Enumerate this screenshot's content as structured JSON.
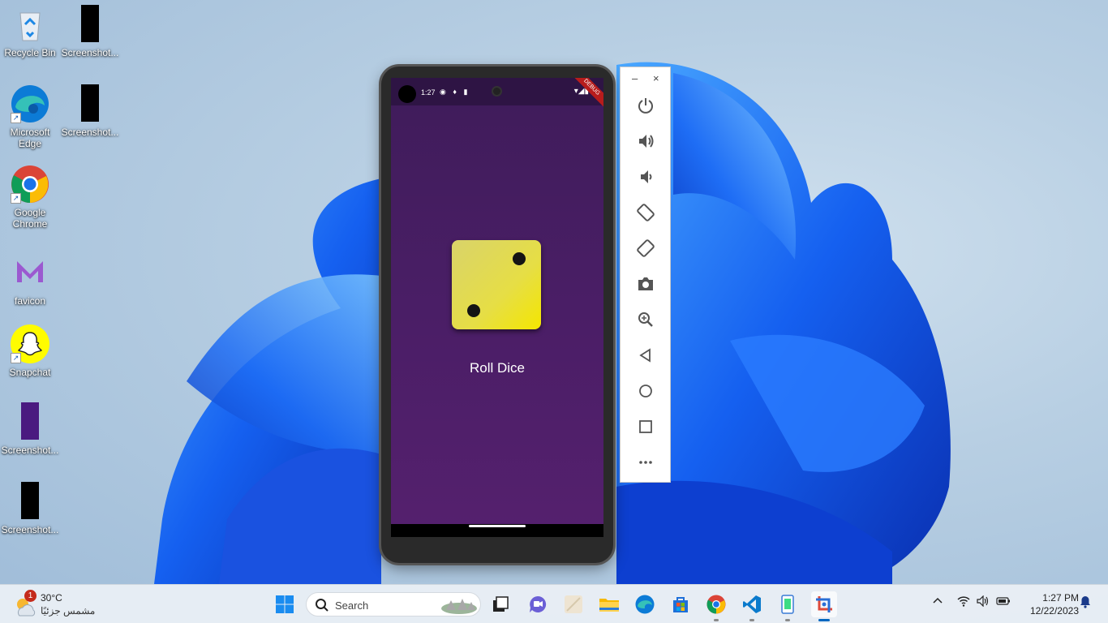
{
  "desktop": {
    "icons": [
      {
        "label": "Recycle Bin"
      },
      {
        "label": "Screenshot..."
      },
      {
        "label": "Microsoft Edge"
      },
      {
        "label": "Screenshot..."
      },
      {
        "label": "Google Chrome"
      },
      {
        "label": "favicon"
      },
      {
        "label": "Snapchat"
      },
      {
        "label": "Screenshot..."
      },
      {
        "label": "Screenshot..."
      }
    ]
  },
  "emulator": {
    "status_time": "1:27",
    "debug_banner": "DEBUG",
    "app": {
      "dice_value": 2,
      "button_label": "Roll Dice",
      "accent_color": "#4a1e66",
      "dice_color": "#e6de45"
    },
    "toolbar": {
      "minimize": "–",
      "close": "×",
      "buttons": [
        "power-icon",
        "volume-up-icon",
        "volume-down-icon",
        "rotate-left-icon",
        "rotate-right-icon",
        "camera-icon",
        "zoom-icon",
        "back-icon",
        "home-icon",
        "overview-icon",
        "more-icon"
      ]
    }
  },
  "taskbar": {
    "weather": {
      "temp": "30°C",
      "condition": "مشمس جزئيًا",
      "badge": "1"
    },
    "search_placeholder": "Search",
    "clock": {
      "time": "1:27 PM",
      "date": "12/22/2023"
    }
  }
}
